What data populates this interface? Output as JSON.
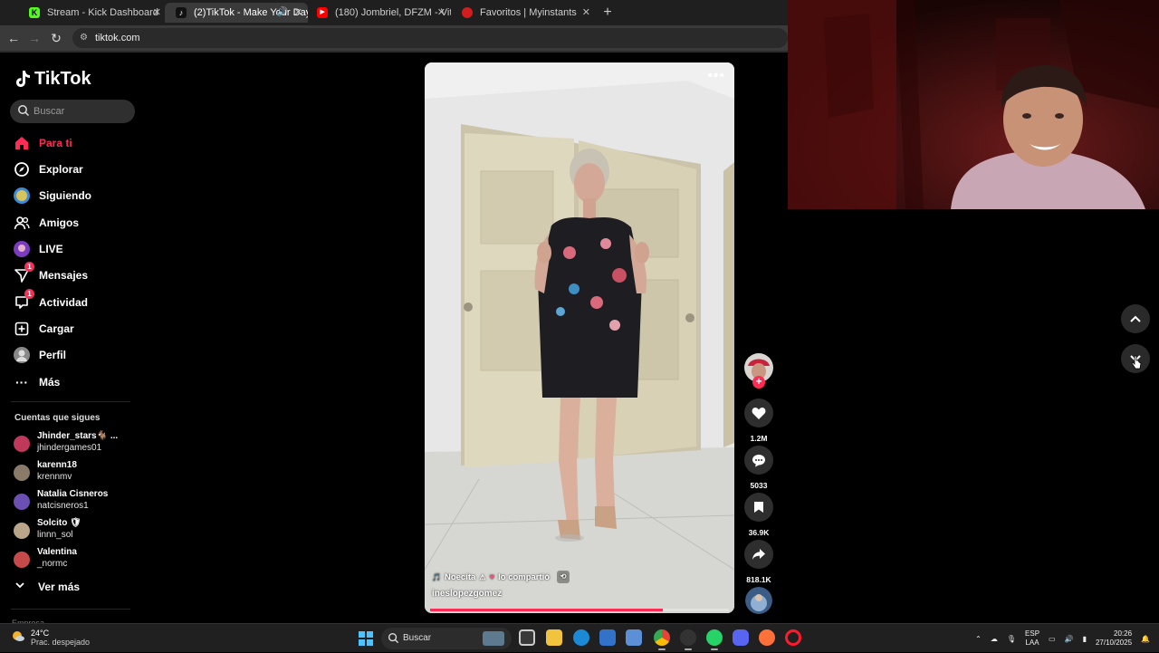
{
  "browser": {
    "tabs": [
      {
        "title": "Stream - Kick Dashboard",
        "icon": "kick-icon",
        "color": "#53fc18",
        "glyph": "K"
      },
      {
        "title": "(2)TikTok - Make Your Day",
        "icon": "tiktok-icon",
        "color": "#111111",
        "glyph": "♪"
      },
      {
        "title": "(180) Jombriel, DFZM - Vitamin",
        "icon": "youtube-icon",
        "color": "#ff0000",
        "glyph": "▶"
      },
      {
        "title": "Favoritos | Myinstants",
        "icon": "myinstants-icon",
        "color": "#d11d1d",
        "glyph": "●"
      }
    ],
    "url": "tiktok.com"
  },
  "sidebar": {
    "logo": "TikTok",
    "search_placeholder": "Buscar",
    "nav": [
      {
        "label": "Para ti",
        "icon": "home-icon",
        "badge": ""
      },
      {
        "label": "Explorar",
        "icon": "compass-icon",
        "badge": ""
      },
      {
        "label": "Siguiendo",
        "icon": "following-icon",
        "badge": ""
      },
      {
        "label": "Amigos",
        "icon": "friends-icon",
        "badge": ""
      },
      {
        "label": "LIVE",
        "icon": "live-icon",
        "badge": ""
      },
      {
        "label": "Mensajes",
        "icon": "messages-icon",
        "badge": "1"
      },
      {
        "label": "Actividad",
        "icon": "activity-icon",
        "badge": "1"
      },
      {
        "label": "Cargar",
        "icon": "upload-icon",
        "badge": ""
      },
      {
        "label": "Perfil",
        "icon": "profile-icon",
        "badge": ""
      },
      {
        "label": "Más",
        "icon": "more-icon",
        "badge": ""
      }
    ],
    "following_title": "Cuentas que sigues",
    "accounts": [
      {
        "name": "Jhinder_stars🐐 ...",
        "handle": "jhindergames01",
        "color": "#c0395a"
      },
      {
        "name": "karenn18",
        "handle": "krennmv",
        "color": "#8a7a6a"
      },
      {
        "name": "Natalia Cisneros",
        "handle": "natcisneros1",
        "color": "#6b4fb3"
      },
      {
        "name": "Solcito 🛡",
        "handle": "linnn_sol",
        "color": "#b9a68a"
      },
      {
        "name": "Valentina",
        "handle": "_normc",
        "color": "#c74a4a"
      }
    ],
    "see_more": "Ver más",
    "footer_cut": "Empresa"
  },
  "video": {
    "shared_user": "Noecita",
    "shared_text": "lo compartió",
    "author": "ineslopezgomez",
    "progress": 0.78
  },
  "actions": {
    "likes": "1.2M",
    "comments": "5033",
    "saves": "36.9K",
    "shares": "818.1K"
  },
  "taskbar": {
    "temp": "24°C",
    "weather": "Prac. despejado",
    "search": "Buscar",
    "lang_top": "ESP",
    "lang_bottom": "LAA",
    "time": "20:26",
    "date": "27/10/2025"
  },
  "colors": {
    "accent": "#fe2c55",
    "sidebar_bg": "#000000"
  }
}
